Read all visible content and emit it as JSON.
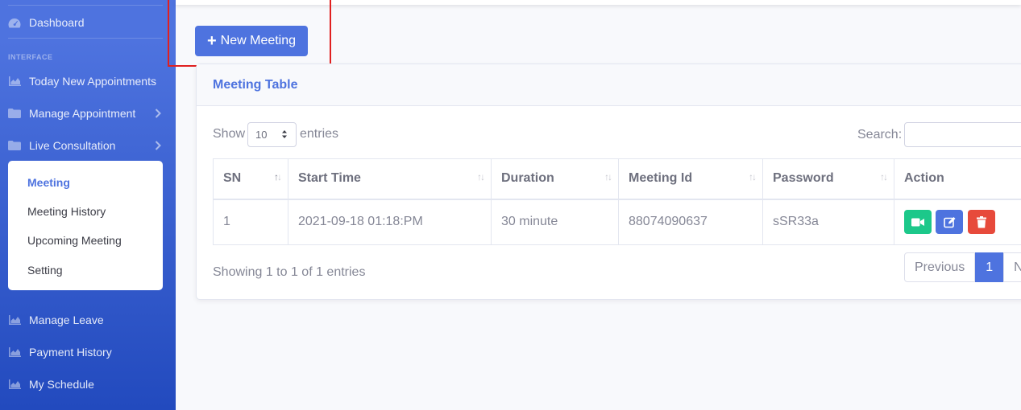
{
  "sidebar": {
    "dashboard": "Dashboard",
    "heading": "INTERFACE",
    "items": {
      "today_new_appointments": "Today New Appointments",
      "manage_appointment": "Manage Appointment",
      "live_consultation": "Live Consultation",
      "manage_leave": "Manage Leave",
      "payment_history": "Payment History",
      "my_schedule": "My Schedule"
    },
    "submenu": {
      "meeting": "Meeting",
      "meeting_history": "Meeting History",
      "upcoming_meeting": "Upcoming Meeting",
      "setting": "Setting"
    }
  },
  "toolbar": {
    "new_meeting_label": "New Meeting"
  },
  "card": {
    "title": "Meeting Table",
    "show_label": "Show",
    "entries_per_page": "10",
    "entries_label": "entries",
    "search_label": "Search:",
    "columns": {
      "sn": "SN",
      "start_time": "Start Time",
      "duration": "Duration",
      "meeting_id": "Meeting Id",
      "password": "Password",
      "action": "Action"
    },
    "rows": [
      {
        "sn": "1",
        "start_time": "2021-09-18 01:18:PM",
        "duration": "30 minute",
        "meeting_id": "88074090637",
        "password": "sSR33a"
      }
    ],
    "info": "Showing 1 to 1 of 1 entries",
    "pagination": {
      "previous": "Previous",
      "current": "1",
      "next": "Next"
    }
  },
  "colors": {
    "primary": "#4e73df",
    "success": "#1cc88a",
    "danger": "#e74a3b",
    "highlight": "#e02020"
  }
}
